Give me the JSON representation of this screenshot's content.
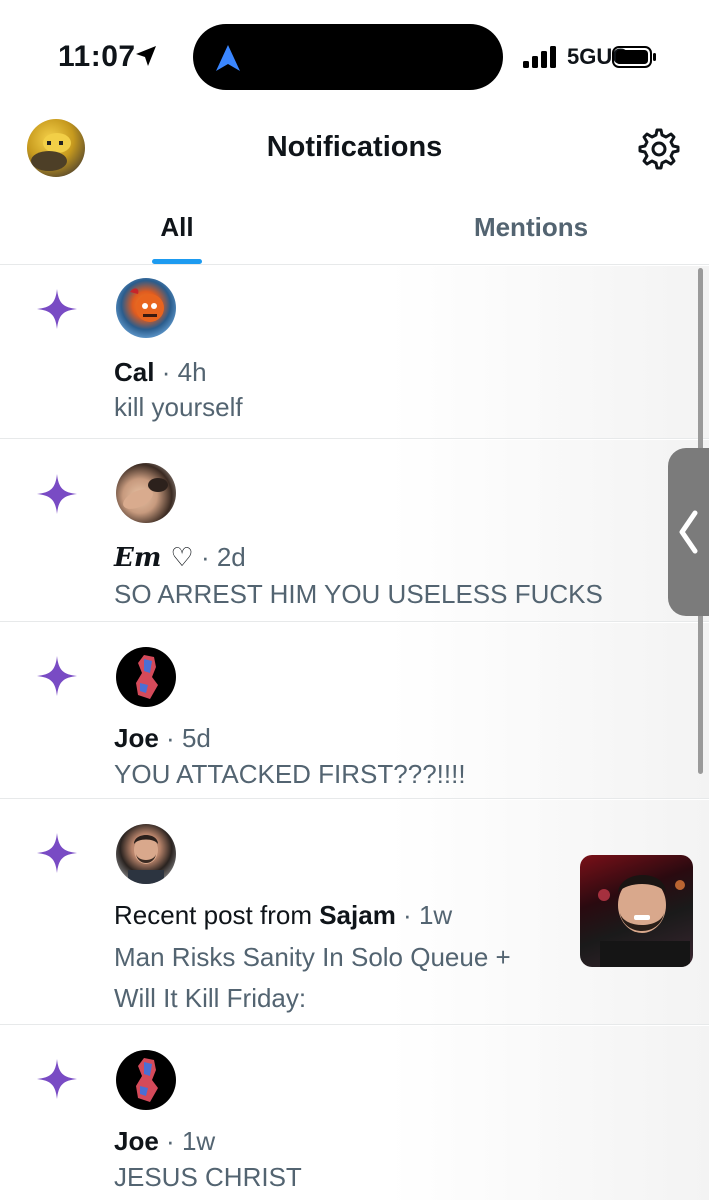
{
  "status_bar": {
    "time": "11:07",
    "network": "5GUC",
    "icons": [
      "location-arrow-icon",
      "navigation-arrow-icon",
      "signal-bars-icon",
      "battery-icon"
    ]
  },
  "header": {
    "title": "Notifications",
    "settings_icon": "gear-icon"
  },
  "tabs": [
    {
      "label": "All",
      "selected": true
    },
    {
      "label": "Mentions",
      "selected": false
    }
  ],
  "colors": {
    "accent": "#1d9bf0",
    "sparkle": "#794bc4",
    "text_primary": "#0f1419",
    "text_secondary": "#536471"
  },
  "notifications": [
    {
      "name": "Cal",
      "separator": "·",
      "time": "4h",
      "text": "kill yourself",
      "icon": "sparkle-icon"
    },
    {
      "name": "Em ♡",
      "separator": "·",
      "time": "2d",
      "text": "SO ARREST HIM YOU USELESS FUCKS",
      "icon": "sparkle-icon"
    },
    {
      "name": "Joe",
      "separator": "·",
      "time": "5d",
      "text": "YOU ATTACKED FIRST???!!!!",
      "icon": "sparkle-icon"
    },
    {
      "prefix": "Recent post from ",
      "name": "Sajam",
      "separator": "·",
      "time": "1w",
      "text": "Man Risks Sanity In Solo Queue + Will It Kill Friday:",
      "icon": "sparkle-icon",
      "has_thumbnail": true
    },
    {
      "name": "Joe",
      "separator": "·",
      "time": "1w",
      "text": "JESUS CHRIST",
      "icon": "sparkle-icon"
    }
  ]
}
